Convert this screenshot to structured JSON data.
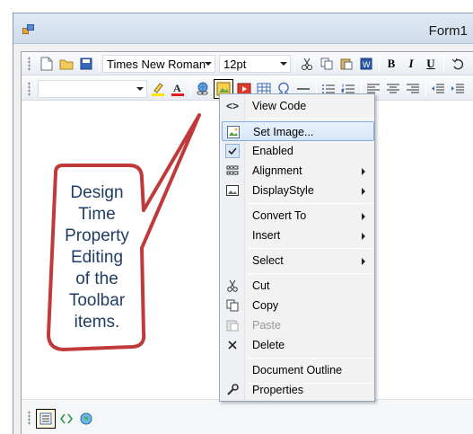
{
  "window": {
    "title": "Form1"
  },
  "toolbar1": {
    "font_name": "Times New Roman",
    "font_size": "12pt",
    "bold": "B",
    "italic": "I",
    "underline": "U"
  },
  "toolbar2": {
    "style_value": ""
  },
  "callout": {
    "lines": [
      "Design",
      "Time",
      "Property",
      "Editing",
      "of the",
      "Toolbar",
      "items."
    ],
    "color": "#c0393b"
  },
  "context_menu": {
    "items": [
      {
        "label": "View Code",
        "icon": "code-brackets-icon"
      },
      {
        "label": "Set Image...",
        "icon": "image-icon",
        "highlighted": true
      },
      {
        "label": "Enabled",
        "icon": "checkmark-icon",
        "checked": true
      },
      {
        "label": "Alignment",
        "icon": "alignment-icon",
        "submenu": true
      },
      {
        "label": "DisplayStyle",
        "icon": "picture-icon",
        "submenu": true
      },
      {
        "label": "Convert To",
        "submenu": true
      },
      {
        "label": "Insert",
        "submenu": true
      },
      {
        "label": "Select",
        "submenu": true
      },
      {
        "label": "Cut",
        "icon": "scissors-icon"
      },
      {
        "label": "Copy",
        "icon": "copy-icon"
      },
      {
        "label": "Paste",
        "icon": "paste-icon",
        "disabled": true
      },
      {
        "label": "Delete",
        "icon": "delete-x-icon"
      },
      {
        "label": "Document Outline"
      },
      {
        "label": "Properties",
        "icon": "wrench-icon"
      }
    ]
  },
  "colors": {
    "accent": "#84acdd",
    "highlight": "#d5e6f8"
  }
}
